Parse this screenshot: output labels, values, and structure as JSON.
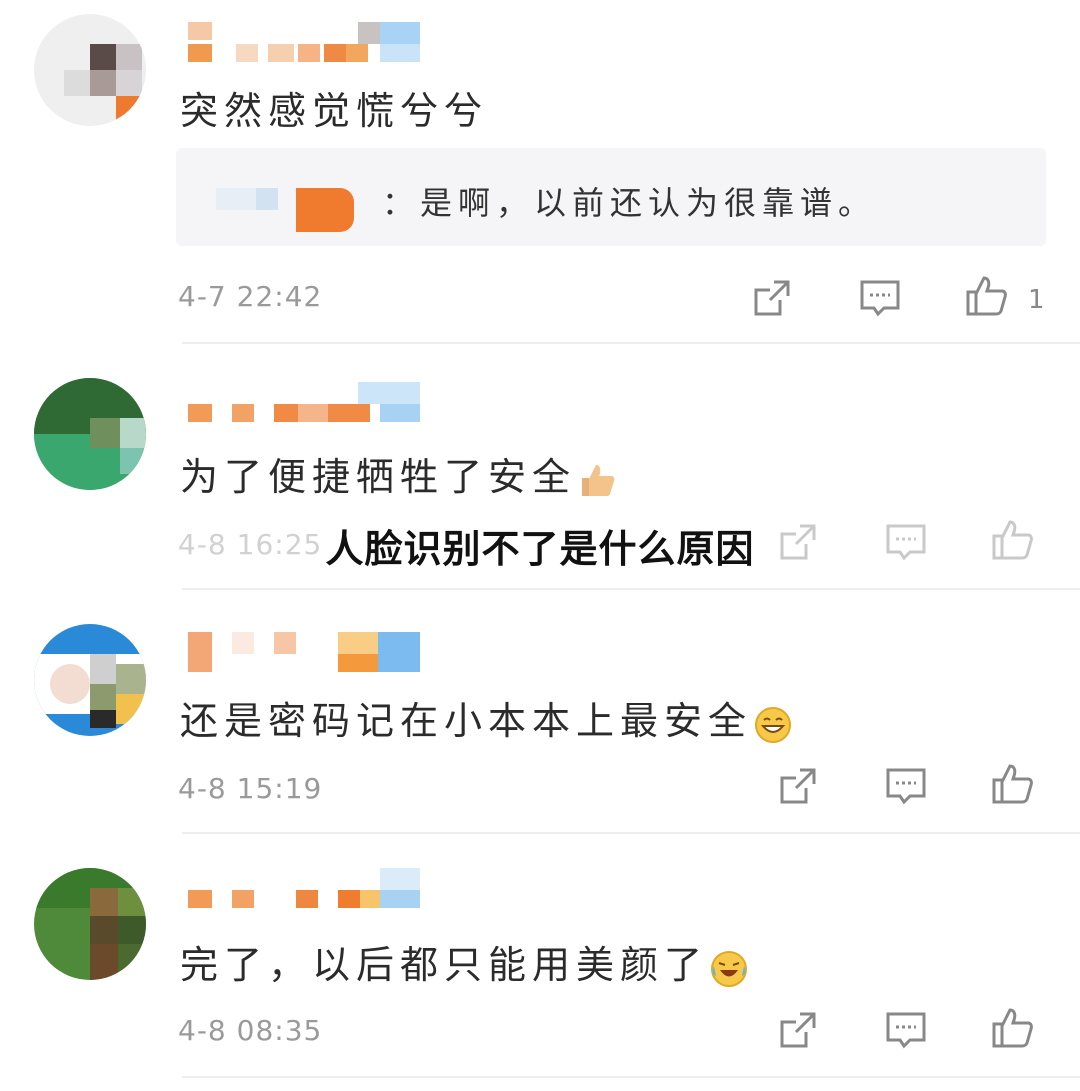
{
  "overlay": {
    "title": "人脸识别不了是什么原因"
  },
  "comments": [
    {
      "text": "突然感觉慌兮兮",
      "reply": {
        "text": "：是啊，以前还认为很靠谱。"
      },
      "time": "4-7 22:42",
      "like_count": "1"
    },
    {
      "text": "为了便捷牺牲了安全",
      "emoji": "thumbs-up",
      "time": "4-8 16:25"
    },
    {
      "text": "还是密码记在小本本上最安全",
      "emoji": "grin",
      "time": "4-8 15:19"
    },
    {
      "text": "完了，以后都只能用美颜了",
      "emoji": "laugh-cry",
      "time": "4-8 08:35"
    }
  ],
  "icons": {
    "share": "share-icon",
    "comment": "comment-icon",
    "like": "thumbs-up-icon"
  },
  "colors": {
    "accent_orange": "#f28a3a",
    "accent_blue": "#8cc4f2",
    "text_gray": "#9a9a9a"
  }
}
